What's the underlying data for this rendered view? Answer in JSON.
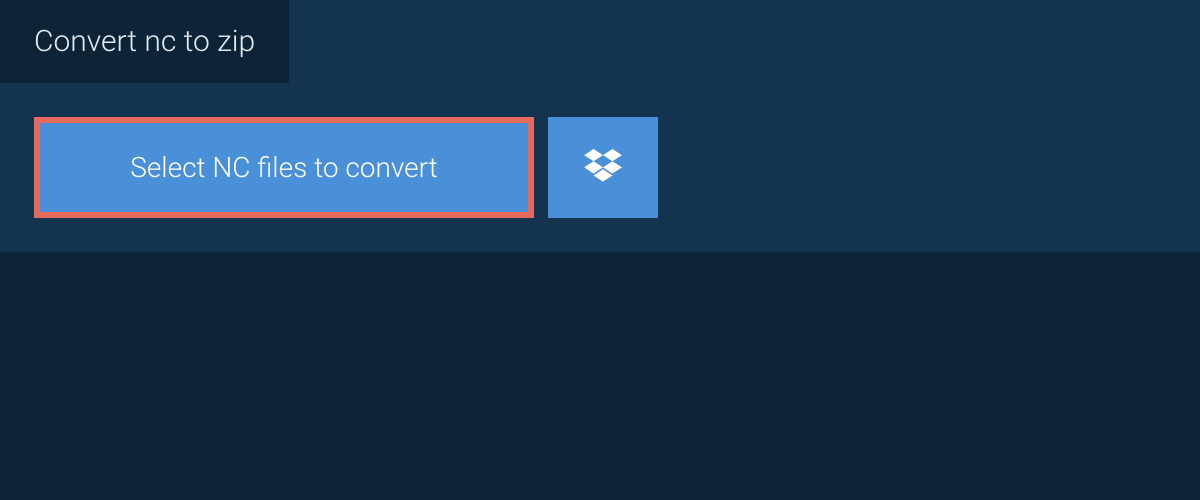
{
  "tab": {
    "label": "Convert nc to zip"
  },
  "actions": {
    "select_label": "Select NC files to convert"
  },
  "colors": {
    "background": "#0d2438",
    "panel": "#14334f",
    "button": "#4a90d9",
    "highlight_border": "#e66a5c",
    "text_light": "#e6ecf1"
  }
}
